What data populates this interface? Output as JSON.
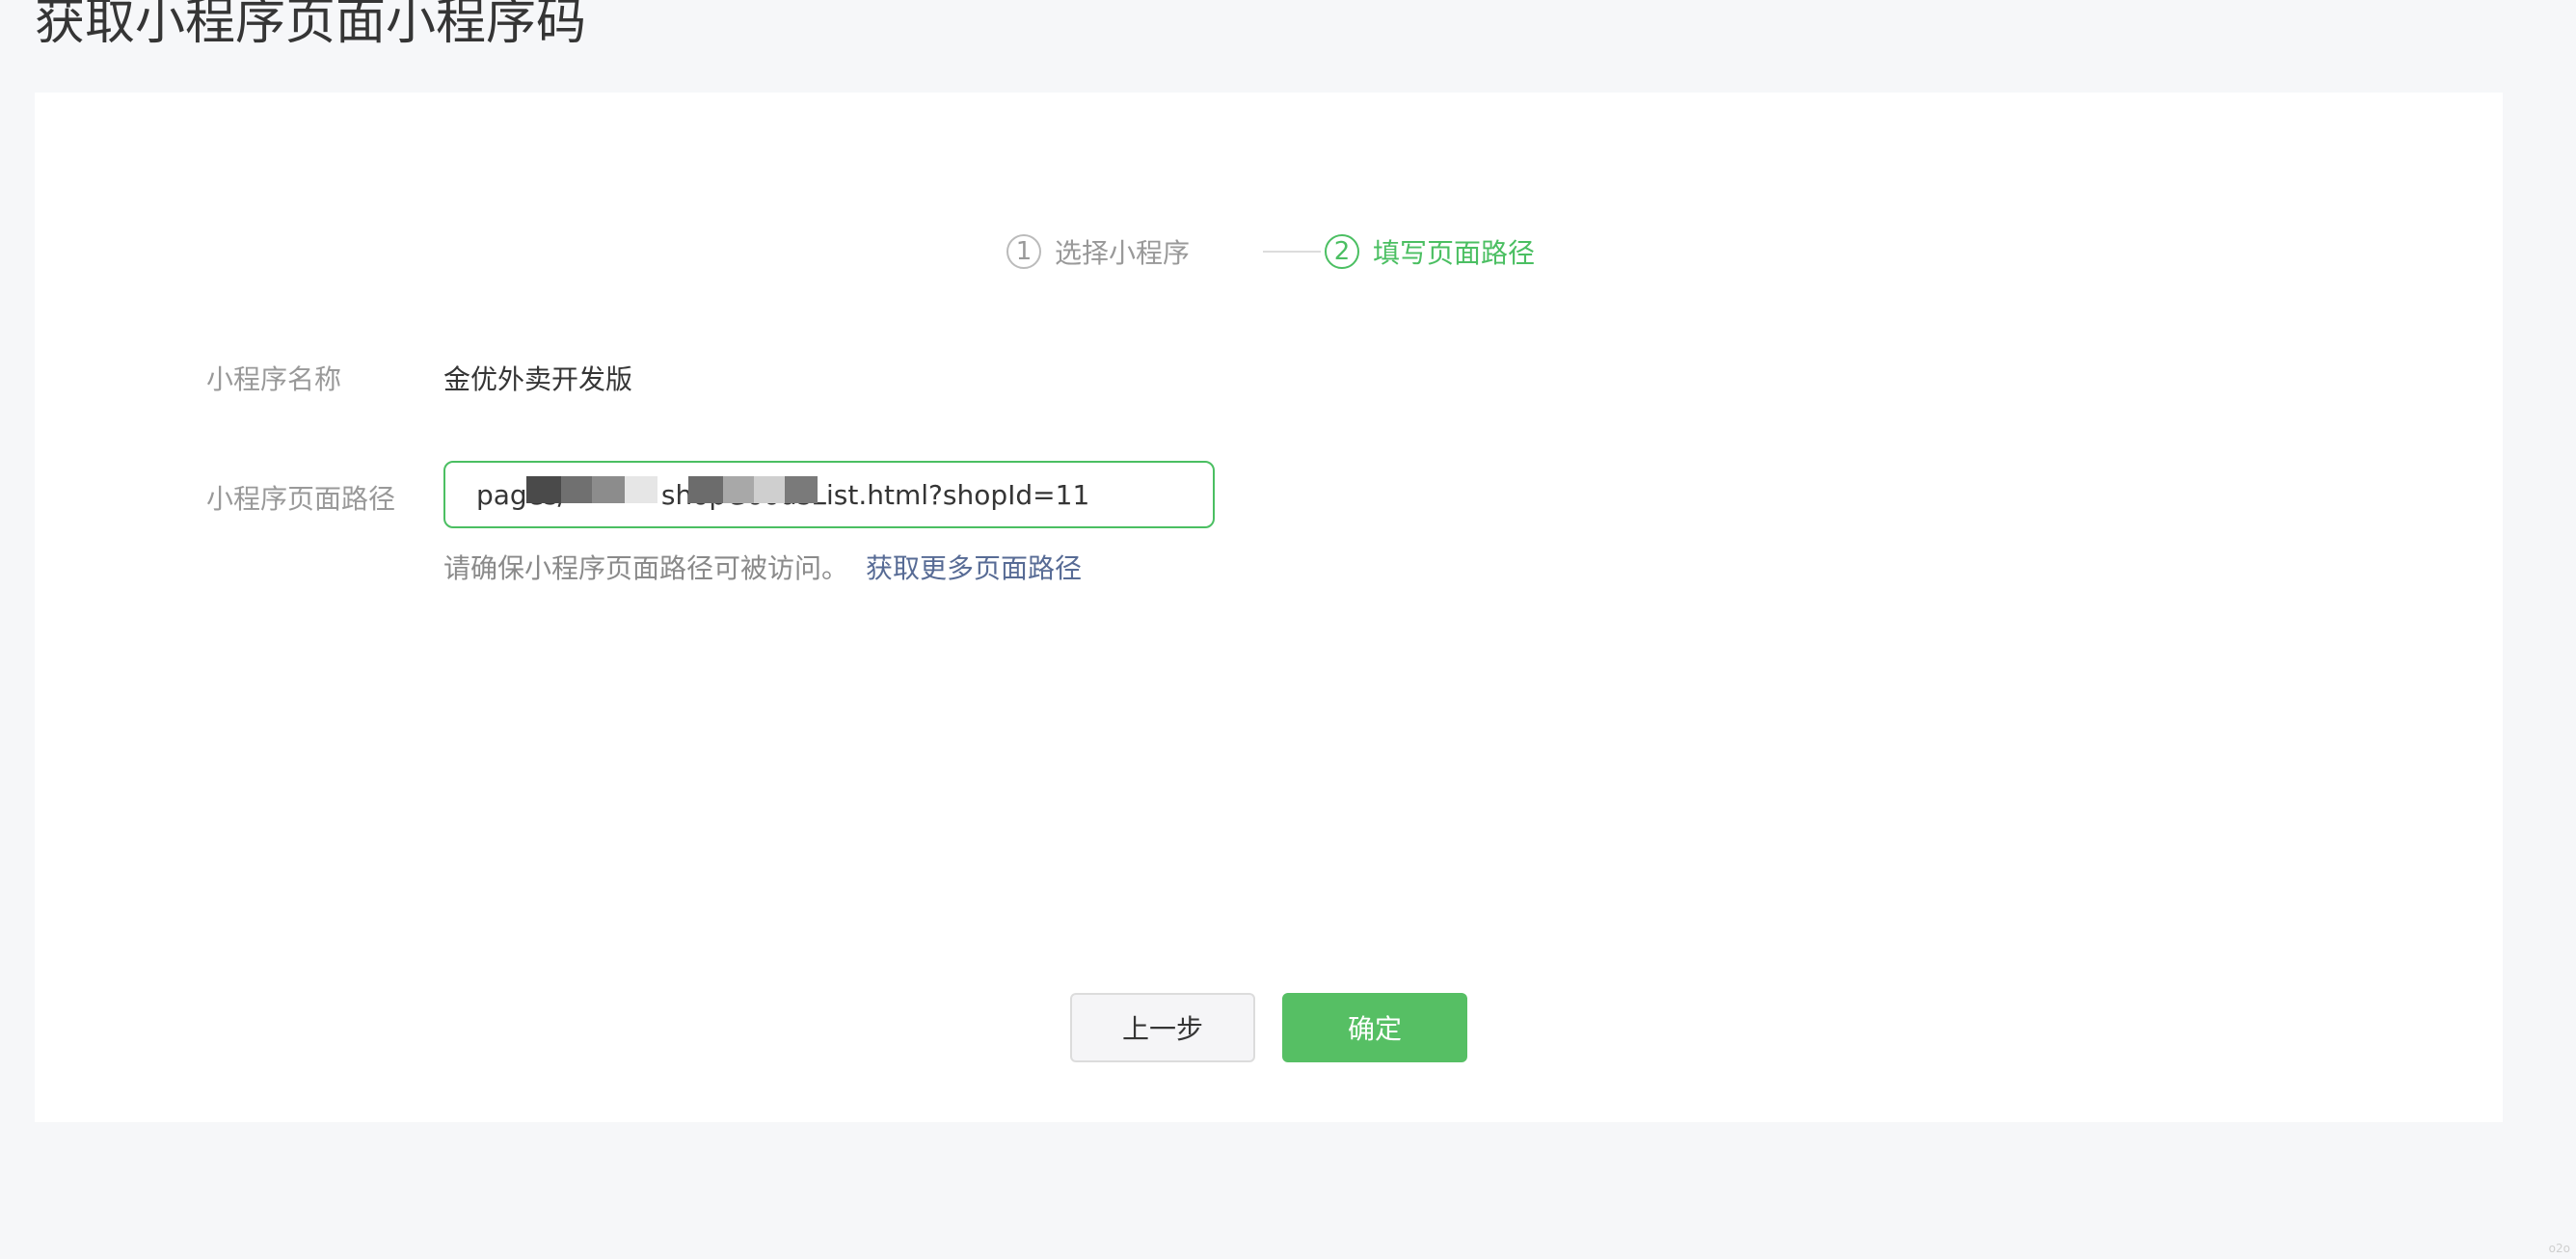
{
  "page": {
    "title": "获取小程序页面小程序码"
  },
  "steps": [
    {
      "number": "1",
      "label": "选择小程序",
      "active": false
    },
    {
      "number": "2",
      "label": "填写页面路径",
      "active": true
    }
  ],
  "form": {
    "name_label": "小程序名称",
    "name_value": "金优外卖开发版",
    "path_label": "小程序页面路径",
    "path_value": "pages/           shopGoodsList.html?shopId=11",
    "hint_text": "请确保小程序页面路径可被访问。",
    "hint_link": "获取更多页面路径"
  },
  "buttons": {
    "prev_label": "上一步",
    "confirm_label": "确定"
  },
  "footer": {
    "watermark": "o2o"
  },
  "colors": {
    "accent": "#4bbf62",
    "confirm_bg": "#56bf64",
    "link": "#576b95",
    "background": "#f6f7f9"
  }
}
